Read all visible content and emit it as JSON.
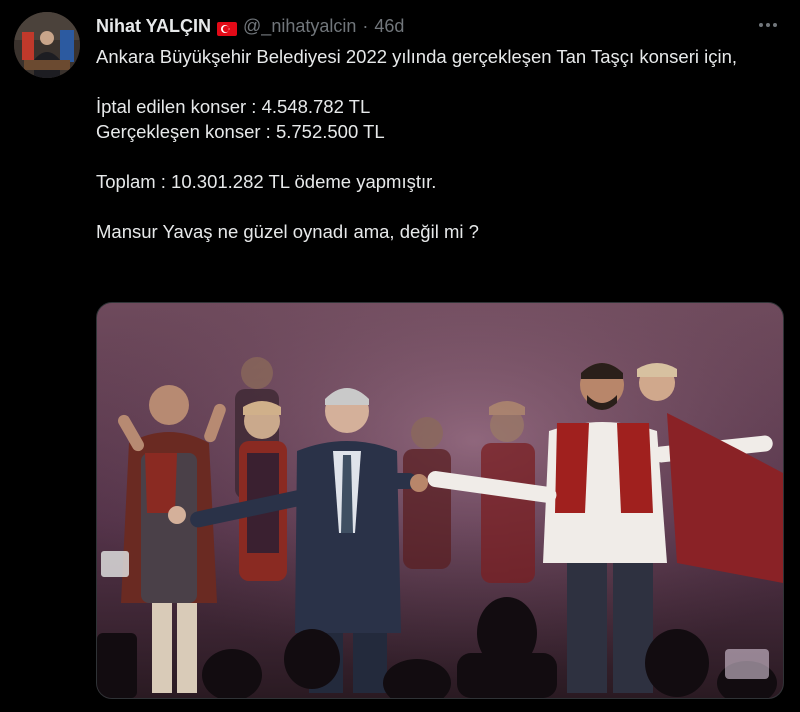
{
  "author": {
    "name": "Nihat YALÇIN",
    "handle": "@_nihatyalcin",
    "separator": "·",
    "time": "46d"
  },
  "icons": {
    "flag": "turkey-flag-icon",
    "more": "more-options-icon"
  },
  "tweet": {
    "line1": "Ankara Büyükşehir Belediyesi 2022 yılında gerçekleşen Tan Taşçı konseri için,",
    "line2": "İptal edilen konser : 4.548.782 TL",
    "line3": "Gerçekleşen konser : 5.752.500 TL",
    "line4": "Toplam : 10.301.282 TL ödeme yapmıştır.",
    "line5": "Mansur Yavaş ne güzel oynadı ama, değil mi ?"
  },
  "colors": {
    "background": "#000000",
    "text": "#e7e9ea",
    "secondary": "#71767b",
    "flag_red": "#e30a17"
  }
}
